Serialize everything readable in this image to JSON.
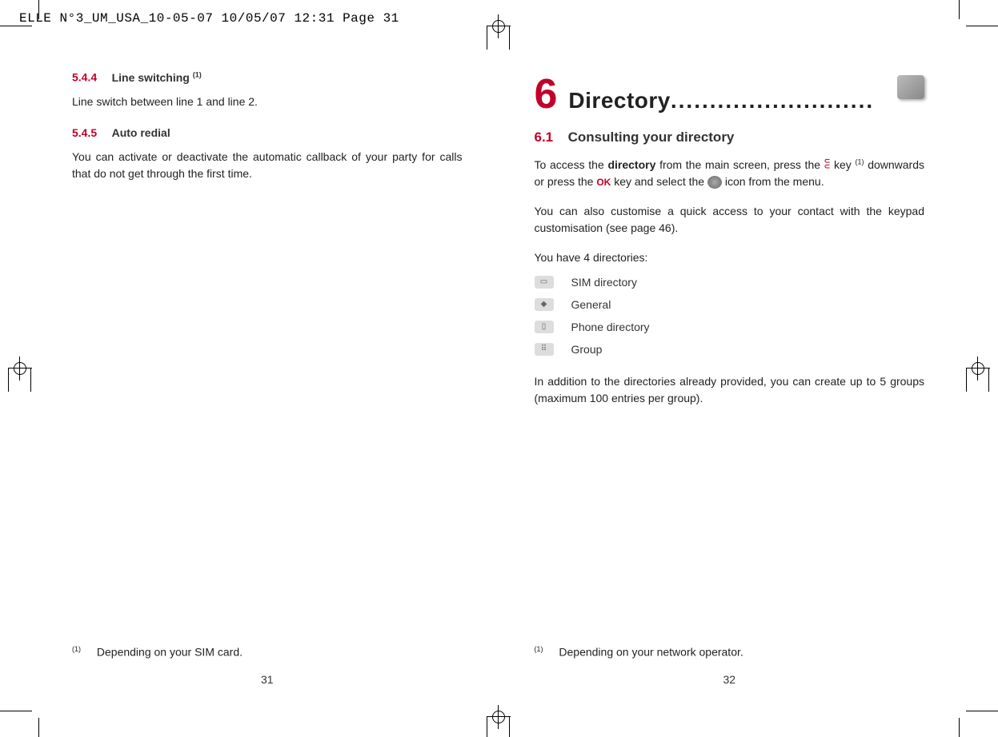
{
  "header_slug": "ELLE N°3_UM_USA_10-05-07  10/05/07  12:31  Page 31",
  "left": {
    "s1_num": "5.4.4",
    "s1_title": "Line switching",
    "s1_sup": "(1)",
    "s1_body": "Line switch between line 1 and line 2.",
    "s2_num": "5.4.5",
    "s2_title": "Auto redial",
    "s2_body": "You can activate or deactivate the automatic callback of your party for calls that do not get through the first time.",
    "footnote_sup": "(1)",
    "footnote_text": "Depending on your SIM card.",
    "page_num": "31"
  },
  "right": {
    "chapter_num": "6",
    "chapter_title": "Directory",
    "chapter_dots": "..........................",
    "sub_num": "6.1",
    "sub_title": "Consulting your directory",
    "p1_a": "To access the ",
    "p1_b_bold": "directory",
    "p1_c": " from the main screen, press the ",
    "p1_d": " key ",
    "p1_sup": "(1)",
    "p1_e": " downwards or press the ",
    "ok_label": "OK",
    "p1_f": " key and select the ",
    "p1_g": " icon from the menu.",
    "p2": "You can also customise a quick access to your contact with the keypad customisation (see page 46).",
    "p3": "You have 4 directories:",
    "dirs": [
      "SIM directory",
      "General",
      "Phone directory",
      "Group"
    ],
    "p4": "In addition to the directories already provided, you can create up to 5 groups (maximum 100 entries per group).",
    "footnote_sup": "(1)",
    "footnote_text": "Depending on your network operator.",
    "page_num": "32"
  }
}
